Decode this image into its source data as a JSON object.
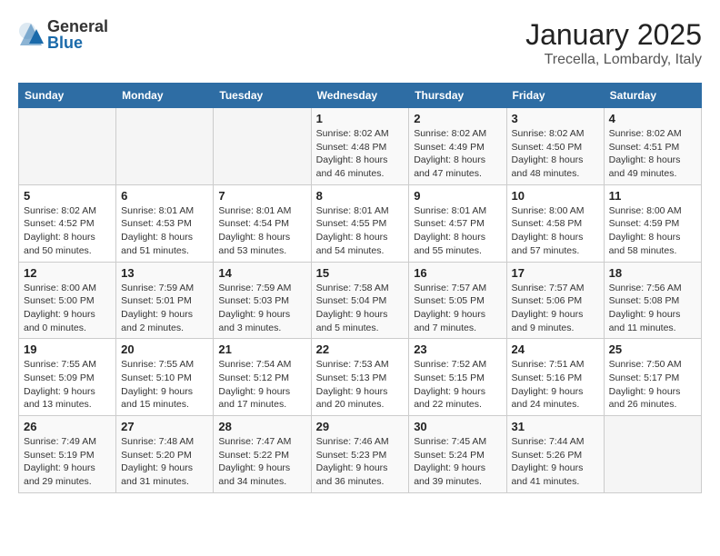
{
  "header": {
    "logo_general": "General",
    "logo_blue": "Blue",
    "month": "January 2025",
    "location": "Trecella, Lombardy, Italy"
  },
  "weekdays": [
    "Sunday",
    "Monday",
    "Tuesday",
    "Wednesday",
    "Thursday",
    "Friday",
    "Saturday"
  ],
  "weeks": [
    [
      {
        "day": "",
        "info": ""
      },
      {
        "day": "",
        "info": ""
      },
      {
        "day": "",
        "info": ""
      },
      {
        "day": "1",
        "info": "Sunrise: 8:02 AM\nSunset: 4:48 PM\nDaylight: 8 hours and 46 minutes."
      },
      {
        "day": "2",
        "info": "Sunrise: 8:02 AM\nSunset: 4:49 PM\nDaylight: 8 hours and 47 minutes."
      },
      {
        "day": "3",
        "info": "Sunrise: 8:02 AM\nSunset: 4:50 PM\nDaylight: 8 hours and 48 minutes."
      },
      {
        "day": "4",
        "info": "Sunrise: 8:02 AM\nSunset: 4:51 PM\nDaylight: 8 hours and 49 minutes."
      }
    ],
    [
      {
        "day": "5",
        "info": "Sunrise: 8:02 AM\nSunset: 4:52 PM\nDaylight: 8 hours and 50 minutes."
      },
      {
        "day": "6",
        "info": "Sunrise: 8:01 AM\nSunset: 4:53 PM\nDaylight: 8 hours and 51 minutes."
      },
      {
        "day": "7",
        "info": "Sunrise: 8:01 AM\nSunset: 4:54 PM\nDaylight: 8 hours and 53 minutes."
      },
      {
        "day": "8",
        "info": "Sunrise: 8:01 AM\nSunset: 4:55 PM\nDaylight: 8 hours and 54 minutes."
      },
      {
        "day": "9",
        "info": "Sunrise: 8:01 AM\nSunset: 4:57 PM\nDaylight: 8 hours and 55 minutes."
      },
      {
        "day": "10",
        "info": "Sunrise: 8:00 AM\nSunset: 4:58 PM\nDaylight: 8 hours and 57 minutes."
      },
      {
        "day": "11",
        "info": "Sunrise: 8:00 AM\nSunset: 4:59 PM\nDaylight: 8 hours and 58 minutes."
      }
    ],
    [
      {
        "day": "12",
        "info": "Sunrise: 8:00 AM\nSunset: 5:00 PM\nDaylight: 9 hours and 0 minutes."
      },
      {
        "day": "13",
        "info": "Sunrise: 7:59 AM\nSunset: 5:01 PM\nDaylight: 9 hours and 2 minutes."
      },
      {
        "day": "14",
        "info": "Sunrise: 7:59 AM\nSunset: 5:03 PM\nDaylight: 9 hours and 3 minutes."
      },
      {
        "day": "15",
        "info": "Sunrise: 7:58 AM\nSunset: 5:04 PM\nDaylight: 9 hours and 5 minutes."
      },
      {
        "day": "16",
        "info": "Sunrise: 7:57 AM\nSunset: 5:05 PM\nDaylight: 9 hours and 7 minutes."
      },
      {
        "day": "17",
        "info": "Sunrise: 7:57 AM\nSunset: 5:06 PM\nDaylight: 9 hours and 9 minutes."
      },
      {
        "day": "18",
        "info": "Sunrise: 7:56 AM\nSunset: 5:08 PM\nDaylight: 9 hours and 11 minutes."
      }
    ],
    [
      {
        "day": "19",
        "info": "Sunrise: 7:55 AM\nSunset: 5:09 PM\nDaylight: 9 hours and 13 minutes."
      },
      {
        "day": "20",
        "info": "Sunrise: 7:55 AM\nSunset: 5:10 PM\nDaylight: 9 hours and 15 minutes."
      },
      {
        "day": "21",
        "info": "Sunrise: 7:54 AM\nSunset: 5:12 PM\nDaylight: 9 hours and 17 minutes."
      },
      {
        "day": "22",
        "info": "Sunrise: 7:53 AM\nSunset: 5:13 PM\nDaylight: 9 hours and 20 minutes."
      },
      {
        "day": "23",
        "info": "Sunrise: 7:52 AM\nSunset: 5:15 PM\nDaylight: 9 hours and 22 minutes."
      },
      {
        "day": "24",
        "info": "Sunrise: 7:51 AM\nSunset: 5:16 PM\nDaylight: 9 hours and 24 minutes."
      },
      {
        "day": "25",
        "info": "Sunrise: 7:50 AM\nSunset: 5:17 PM\nDaylight: 9 hours and 26 minutes."
      }
    ],
    [
      {
        "day": "26",
        "info": "Sunrise: 7:49 AM\nSunset: 5:19 PM\nDaylight: 9 hours and 29 minutes."
      },
      {
        "day": "27",
        "info": "Sunrise: 7:48 AM\nSunset: 5:20 PM\nDaylight: 9 hours and 31 minutes."
      },
      {
        "day": "28",
        "info": "Sunrise: 7:47 AM\nSunset: 5:22 PM\nDaylight: 9 hours and 34 minutes."
      },
      {
        "day": "29",
        "info": "Sunrise: 7:46 AM\nSunset: 5:23 PM\nDaylight: 9 hours and 36 minutes."
      },
      {
        "day": "30",
        "info": "Sunrise: 7:45 AM\nSunset: 5:24 PM\nDaylight: 9 hours and 39 minutes."
      },
      {
        "day": "31",
        "info": "Sunrise: 7:44 AM\nSunset: 5:26 PM\nDaylight: 9 hours and 41 minutes."
      },
      {
        "day": "",
        "info": ""
      }
    ]
  ]
}
